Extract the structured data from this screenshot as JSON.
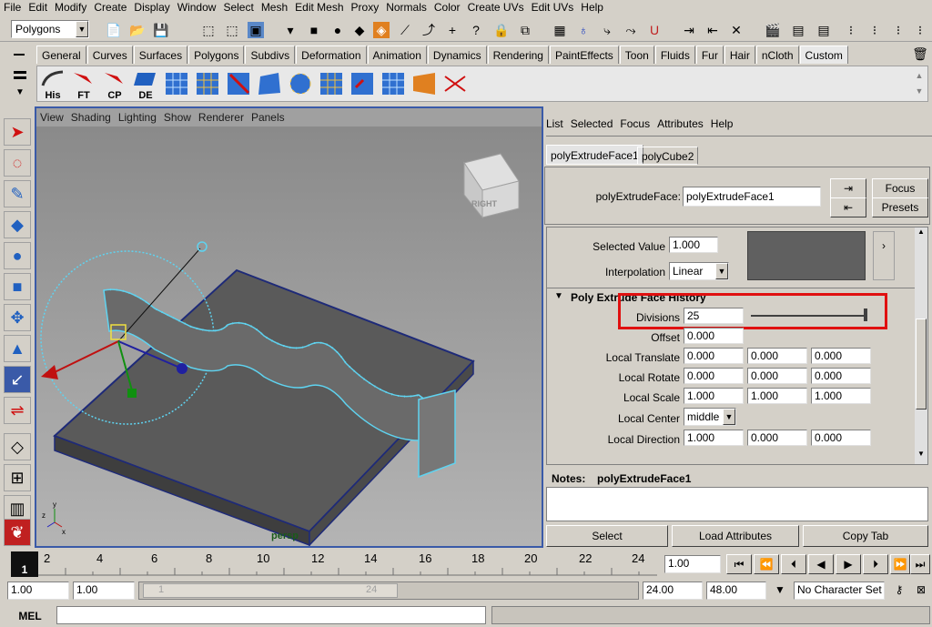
{
  "menubar": [
    "File",
    "Edit",
    "Modify",
    "Create",
    "Display",
    "Window",
    "Select",
    "Mesh",
    "Edit Mesh",
    "Proxy",
    "Normals",
    "Color",
    "Create UVs",
    "Edit UVs",
    "Help"
  ],
  "statusline": {
    "menu_set": "Polygons"
  },
  "shelf": {
    "tabs": [
      "General",
      "Curves",
      "Surfaces",
      "Polygons",
      "Subdivs",
      "Deformation",
      "Animation",
      "Dynamics",
      "Rendering",
      "PaintEffects",
      "Toon",
      "Fluids",
      "Fur",
      "Hair",
      "nCloth",
      "Custom"
    ],
    "active_tab": "Custom",
    "buttons": [
      "His",
      "FT",
      "CP",
      "DE"
    ]
  },
  "viewport": {
    "menu": [
      "View",
      "Shading",
      "Lighting",
      "Show",
      "Renderer",
      "Panels"
    ],
    "camera_label": "persp",
    "viewcube_label": "RIGHT",
    "axis_labels": [
      "y",
      "z",
      "x"
    ]
  },
  "attr_editor": {
    "menu": [
      "List",
      "Selected",
      "Focus",
      "Attributes",
      "Help"
    ],
    "tabs": [
      "polyExtrudeFace1",
      "polyCube2"
    ],
    "node_label": "polyExtrudeFace:",
    "node_value": "polyExtrudeFace1",
    "focus_label": "Focus",
    "presets_label": "Presets",
    "selected_value_label": "Selected Value",
    "selected_value": "1.000",
    "interpolation_label": "Interpolation",
    "interpolation_value": "Linear",
    "section_title": "Poly Extrude Face History",
    "divisions_label": "Divisions",
    "divisions_value": "25",
    "offset_label": "Offset",
    "offset_value": "0.000",
    "rows": [
      {
        "label": "Local Translate",
        "values": [
          "0.000",
          "0.000",
          "0.000"
        ]
      },
      {
        "label": "Local Rotate",
        "values": [
          "0.000",
          "0.000",
          "0.000"
        ]
      },
      {
        "label": "Local Scale",
        "values": [
          "1.000",
          "1.000",
          "1.000"
        ]
      }
    ],
    "local_center_label": "Local Center",
    "local_center_value": "middle",
    "local_direction": {
      "label": "Local Direction",
      "values": [
        "1.000",
        "0.000",
        "0.000"
      ]
    },
    "notes_label": "Notes:",
    "notes_node": "polyExtrudeFace1",
    "bottom_buttons": [
      "Select",
      "Load Attributes",
      "Copy Tab"
    ]
  },
  "timeline": {
    "ticks": [
      "2",
      "4",
      "6",
      "8",
      "10",
      "12",
      "14",
      "16",
      "18",
      "20",
      "22",
      "24"
    ],
    "current_frame_marker": "1",
    "current_time": "1.00"
  },
  "range": {
    "start": "1.00",
    "playback_start": "1.00",
    "slider_start": "1",
    "slider_end": "24",
    "playback_end": "24.00",
    "end": "48.00",
    "character_set": "No Character Set"
  },
  "command_line": {
    "label": "MEL"
  },
  "colors": {
    "accent_blue": "#3a5aa8",
    "highlight_red": "#e01010",
    "wire_cyan": "#5fd3f0"
  }
}
